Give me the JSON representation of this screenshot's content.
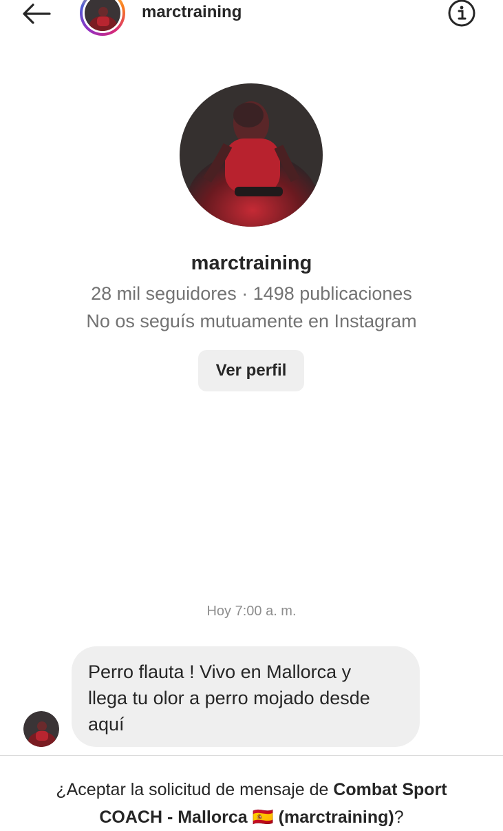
{
  "header": {
    "username": "marctraining",
    "back_icon": "arrow-left-icon",
    "info_icon": "info-icon"
  },
  "profile": {
    "name": "marctraining",
    "stats": "28 mil seguidores · 1498 publicaciones",
    "mutual": "No os seguís mutuamente en Instagram",
    "view_profile_label": "Ver perfil"
  },
  "thread": {
    "timestamp": "Hoy 7:00 a. m.",
    "message": "Perro flauta ! Vivo en Mallorca y\nllega tu olor a perro mojado desde\naquí"
  },
  "request": {
    "prefix": "¿Aceptar la solicitud de mensaje de ",
    "account_name": "Combat Sport\nCOACH - Mallorca 🇪🇸 (marctraining)",
    "suffix": "?"
  },
  "colors": {
    "text_primary": "#262626",
    "text_secondary": "#737373",
    "bubble_bg": "#efefef",
    "button_bg": "#efefef"
  }
}
